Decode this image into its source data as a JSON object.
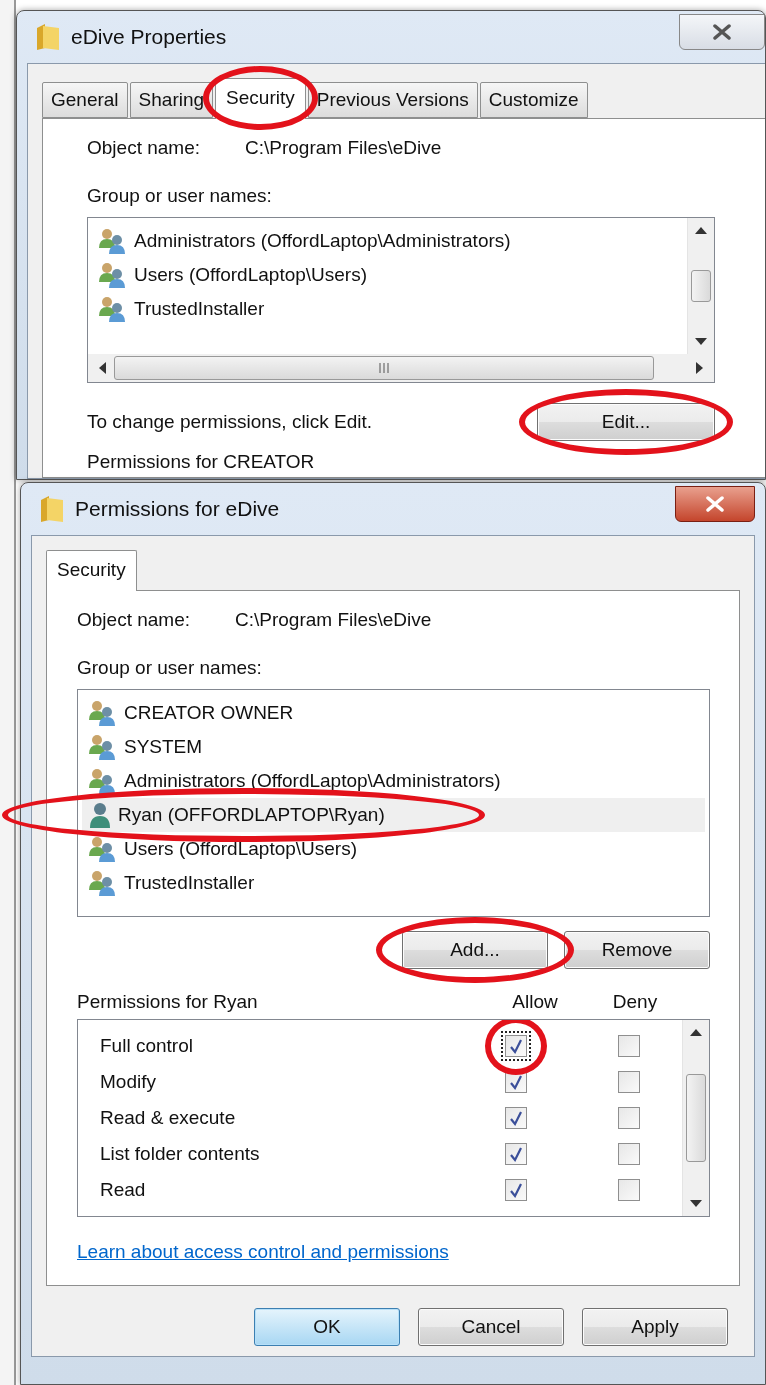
{
  "properties_window": {
    "title": "eDive Properties",
    "tabs": [
      {
        "label": "General",
        "selected": false,
        "highlighted": false
      },
      {
        "label": "Sharing",
        "selected": false,
        "highlighted": false
      },
      {
        "label": "Security",
        "selected": true,
        "highlighted": true
      },
      {
        "label": "Previous Versions",
        "selected": false,
        "highlighted": false
      },
      {
        "label": "Customize",
        "selected": false,
        "highlighted": false
      }
    ],
    "object_name_label": "Object name:",
    "object_name": "C:\\Program Files\\eDive",
    "group_label": "Group or user names:",
    "users": [
      {
        "name": "Administrators (OffordLaptop\\Administrators)",
        "kind": "group"
      },
      {
        "name": "Users (OffordLaptop\\Users)",
        "kind": "group"
      },
      {
        "name": "TrustedInstaller",
        "kind": "group"
      }
    ],
    "hint": "To change permissions, click Edit.",
    "edit_button": {
      "label": "Edit...",
      "highlighted": true
    },
    "permissions_label": "Permissions for CREATOR"
  },
  "permissions_window": {
    "title": "Permissions for eDive",
    "tabs": [
      {
        "label": "Security",
        "selected": true
      }
    ],
    "object_name_label": "Object name:",
    "object_name": "C:\\Program Files\\eDive",
    "group_label": "Group or user names:",
    "users": [
      {
        "name": "CREATOR OWNER",
        "kind": "group",
        "selected": false,
        "highlighted": false
      },
      {
        "name": "SYSTEM",
        "kind": "group",
        "selected": false,
        "highlighted": false
      },
      {
        "name": "Administrators (OffordLaptop\\Administrators)",
        "kind": "group",
        "selected": false,
        "highlighted": false
      },
      {
        "name": "Ryan (OFFORDLAPTOP\\Ryan)",
        "kind": "user",
        "selected": true,
        "highlighted": true
      },
      {
        "name": "Users (OffordLaptop\\Users)",
        "kind": "group",
        "selected": false,
        "highlighted": false
      },
      {
        "name": "TrustedInstaller",
        "kind": "group",
        "selected": false,
        "highlighted": false
      }
    ],
    "list_buttons": [
      {
        "label": "Add...",
        "highlighted": true
      },
      {
        "label": "Remove",
        "highlighted": false
      }
    ],
    "permissions_label": "Permissions for Ryan",
    "allow_header": "Allow",
    "deny_header": "Deny",
    "permissions": [
      {
        "name": "Full control",
        "allow": true,
        "deny": false,
        "focused": true,
        "highlighted": true
      },
      {
        "name": "Modify",
        "allow": true,
        "deny": false,
        "focused": false,
        "highlighted": false
      },
      {
        "name": "Read & execute",
        "allow": true,
        "deny": false,
        "focused": false,
        "highlighted": false
      },
      {
        "name": "List folder contents",
        "allow": true,
        "deny": false,
        "focused": false,
        "highlighted": false
      },
      {
        "name": "Read",
        "allow": true,
        "deny": false,
        "focused": false,
        "highlighted": false
      }
    ],
    "link": "Learn about access control and permissions",
    "buttons": [
      {
        "label": "OK",
        "default": true
      },
      {
        "label": "Cancel",
        "default": false
      },
      {
        "label": "Apply",
        "default": false
      }
    ]
  }
}
